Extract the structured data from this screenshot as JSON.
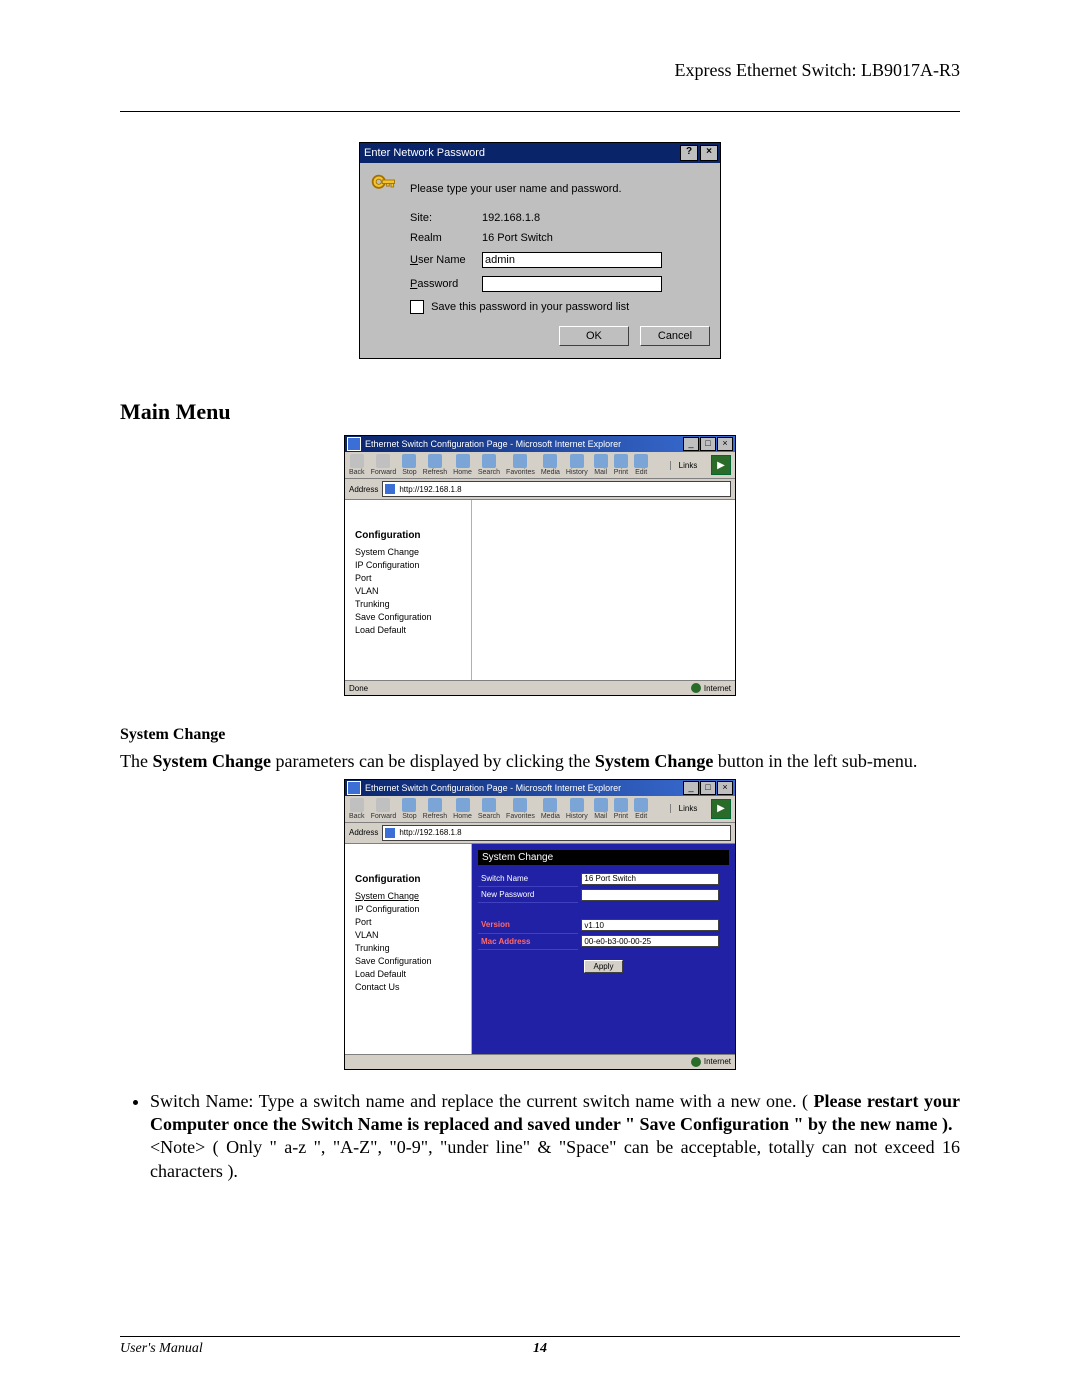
{
  "header": {
    "product": "Express Ethernet Switch: LB9017A-R3"
  },
  "dialog": {
    "title": "Enter Network Password",
    "help_btn": "?",
    "close_btn": "×",
    "prompt": "Please type your user name and password.",
    "labels": {
      "site": "Site:",
      "realm": "Realm",
      "user": "User Name",
      "pass": "Password"
    },
    "values": {
      "site": "192.168.1.8",
      "realm": "16 Port Switch",
      "user": "admin",
      "pass": ""
    },
    "save_label": "Save this password in your password list",
    "ok": "OK",
    "cancel": "Cancel"
  },
  "headings": {
    "main_menu": "Main Menu",
    "system_change": "System Change"
  },
  "ie_common": {
    "window_title": "Ethernet Switch Configuration Page - Microsoft Internet Explorer",
    "toolbar": [
      "Back",
      "Forward",
      "Stop",
      "Refresh",
      "Home",
      "Search",
      "Favorites",
      "Media",
      "History",
      "Mail",
      "Print",
      "Edit"
    ],
    "links": "Links",
    "address_label": "Address",
    "address": "http://192.168.1.8",
    "status_done": "Done",
    "status_zone": "Internet",
    "min": "_",
    "max": "□",
    "close": "×"
  },
  "ie1": {
    "config_head": "Configuration",
    "menu": [
      "System Change",
      "IP Configuration",
      "Port",
      "VLAN",
      "Trunking",
      "Save Configuration",
      "Load Default"
    ]
  },
  "ie2": {
    "config_head": "Configuration",
    "menu": [
      "System Change",
      "IP Configuration",
      "Port",
      "VLAN",
      "Trunking",
      "Save Configuration",
      "Load Default",
      "Contact Us"
    ],
    "panel_title": "System Change",
    "rows": {
      "switch_name_lbl": "Switch Name",
      "switch_name_val": "16 Port Switch",
      "new_pass_lbl": "New Password",
      "new_pass_val": "",
      "version_lbl": "Version",
      "version_val": "v1.10",
      "mac_lbl": "Mac Address",
      "mac_val": "00-e0-b3-00-00-25"
    },
    "apply": "Apply"
  },
  "paragraphs": {
    "sc_intro_pre": "The ",
    "sc_intro_b1": "System Change",
    "sc_intro_mid": " parameters can be displayed by clicking the ",
    "sc_intro_b2": "System Change",
    "sc_intro_post": " button in the left sub-menu.",
    "bullet_lead": "Switch Name: Type a switch name and replace the current switch name with a new one.  ( ",
    "bullet_bold": "Please restart your Computer once the Switch Name is replaced and saved under \" Save Configuration \" by the new name ).",
    "note": "<Note> ( Only \" a-z \", \"A-Z\", \"0-9\", \"under line\" & \"Space\" can be acceptable, totally can not exceed 16 characters )."
  },
  "footer": {
    "left": "User's Manual",
    "page": "14"
  }
}
